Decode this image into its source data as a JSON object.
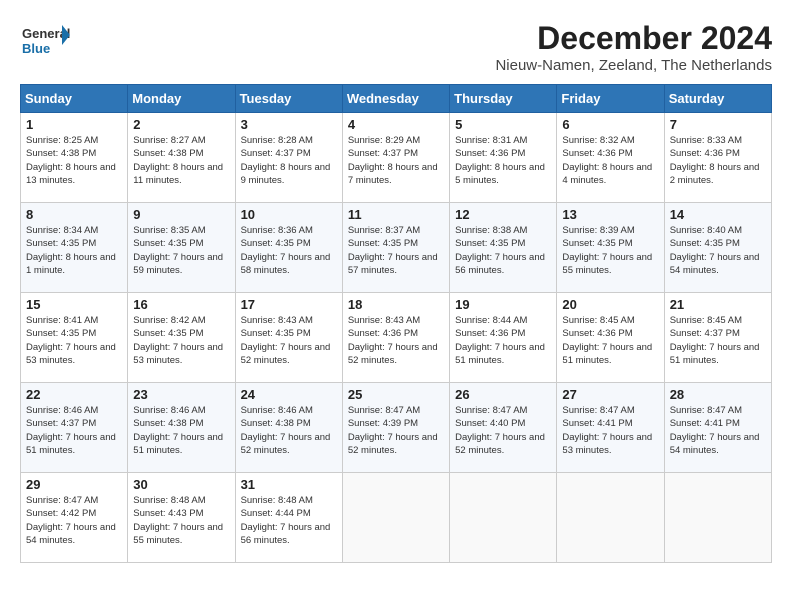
{
  "header": {
    "logo_general": "General",
    "logo_blue": "Blue",
    "main_title": "December 2024",
    "subtitle": "Nieuw-Namen, Zeeland, The Netherlands"
  },
  "calendar": {
    "days_of_week": [
      "Sunday",
      "Monday",
      "Tuesday",
      "Wednesday",
      "Thursday",
      "Friday",
      "Saturday"
    ],
    "weeks": [
      [
        null,
        {
          "day": 2,
          "sunrise": "Sunrise: 8:27 AM",
          "sunset": "Sunset: 4:38 PM",
          "daylight": "Daylight: 8 hours and 11 minutes."
        },
        {
          "day": 3,
          "sunrise": "Sunrise: 8:28 AM",
          "sunset": "Sunset: 4:37 PM",
          "daylight": "Daylight: 8 hours and 9 minutes."
        },
        {
          "day": 4,
          "sunrise": "Sunrise: 8:29 AM",
          "sunset": "Sunset: 4:37 PM",
          "daylight": "Daylight: 8 hours and 7 minutes."
        },
        {
          "day": 5,
          "sunrise": "Sunrise: 8:31 AM",
          "sunset": "Sunset: 4:36 PM",
          "daylight": "Daylight: 8 hours and 5 minutes."
        },
        {
          "day": 6,
          "sunrise": "Sunrise: 8:32 AM",
          "sunset": "Sunset: 4:36 PM",
          "daylight": "Daylight: 8 hours and 4 minutes."
        },
        {
          "day": 7,
          "sunrise": "Sunrise: 8:33 AM",
          "sunset": "Sunset: 4:36 PM",
          "daylight": "Daylight: 8 hours and 2 minutes."
        }
      ],
      [
        {
          "day": 1,
          "sunrise": "Sunrise: 8:25 AM",
          "sunset": "Sunset: 4:38 PM",
          "daylight": "Daylight: 8 hours and 13 minutes."
        },
        null,
        null,
        null,
        null,
        null,
        null
      ],
      [
        {
          "day": 8,
          "sunrise": "Sunrise: 8:34 AM",
          "sunset": "Sunset: 4:35 PM",
          "daylight": "Daylight: 8 hours and 1 minute."
        },
        {
          "day": 9,
          "sunrise": "Sunrise: 8:35 AM",
          "sunset": "Sunset: 4:35 PM",
          "daylight": "Daylight: 7 hours and 59 minutes."
        },
        {
          "day": 10,
          "sunrise": "Sunrise: 8:36 AM",
          "sunset": "Sunset: 4:35 PM",
          "daylight": "Daylight: 7 hours and 58 minutes."
        },
        {
          "day": 11,
          "sunrise": "Sunrise: 8:37 AM",
          "sunset": "Sunset: 4:35 PM",
          "daylight": "Daylight: 7 hours and 57 minutes."
        },
        {
          "day": 12,
          "sunrise": "Sunrise: 8:38 AM",
          "sunset": "Sunset: 4:35 PM",
          "daylight": "Daylight: 7 hours and 56 minutes."
        },
        {
          "day": 13,
          "sunrise": "Sunrise: 8:39 AM",
          "sunset": "Sunset: 4:35 PM",
          "daylight": "Daylight: 7 hours and 55 minutes."
        },
        {
          "day": 14,
          "sunrise": "Sunrise: 8:40 AM",
          "sunset": "Sunset: 4:35 PM",
          "daylight": "Daylight: 7 hours and 54 minutes."
        }
      ],
      [
        {
          "day": 15,
          "sunrise": "Sunrise: 8:41 AM",
          "sunset": "Sunset: 4:35 PM",
          "daylight": "Daylight: 7 hours and 53 minutes."
        },
        {
          "day": 16,
          "sunrise": "Sunrise: 8:42 AM",
          "sunset": "Sunset: 4:35 PM",
          "daylight": "Daylight: 7 hours and 53 minutes."
        },
        {
          "day": 17,
          "sunrise": "Sunrise: 8:43 AM",
          "sunset": "Sunset: 4:35 PM",
          "daylight": "Daylight: 7 hours and 52 minutes."
        },
        {
          "day": 18,
          "sunrise": "Sunrise: 8:43 AM",
          "sunset": "Sunset: 4:36 PM",
          "daylight": "Daylight: 7 hours and 52 minutes."
        },
        {
          "day": 19,
          "sunrise": "Sunrise: 8:44 AM",
          "sunset": "Sunset: 4:36 PM",
          "daylight": "Daylight: 7 hours and 51 minutes."
        },
        {
          "day": 20,
          "sunrise": "Sunrise: 8:45 AM",
          "sunset": "Sunset: 4:36 PM",
          "daylight": "Daylight: 7 hours and 51 minutes."
        },
        {
          "day": 21,
          "sunrise": "Sunrise: 8:45 AM",
          "sunset": "Sunset: 4:37 PM",
          "daylight": "Daylight: 7 hours and 51 minutes."
        }
      ],
      [
        {
          "day": 22,
          "sunrise": "Sunrise: 8:46 AM",
          "sunset": "Sunset: 4:37 PM",
          "daylight": "Daylight: 7 hours and 51 minutes."
        },
        {
          "day": 23,
          "sunrise": "Sunrise: 8:46 AM",
          "sunset": "Sunset: 4:38 PM",
          "daylight": "Daylight: 7 hours and 51 minutes."
        },
        {
          "day": 24,
          "sunrise": "Sunrise: 8:46 AM",
          "sunset": "Sunset: 4:38 PM",
          "daylight": "Daylight: 7 hours and 52 minutes."
        },
        {
          "day": 25,
          "sunrise": "Sunrise: 8:47 AM",
          "sunset": "Sunset: 4:39 PM",
          "daylight": "Daylight: 7 hours and 52 minutes."
        },
        {
          "day": 26,
          "sunrise": "Sunrise: 8:47 AM",
          "sunset": "Sunset: 4:40 PM",
          "daylight": "Daylight: 7 hours and 52 minutes."
        },
        {
          "day": 27,
          "sunrise": "Sunrise: 8:47 AM",
          "sunset": "Sunset: 4:41 PM",
          "daylight": "Daylight: 7 hours and 53 minutes."
        },
        {
          "day": 28,
          "sunrise": "Sunrise: 8:47 AM",
          "sunset": "Sunset: 4:41 PM",
          "daylight": "Daylight: 7 hours and 54 minutes."
        }
      ],
      [
        {
          "day": 29,
          "sunrise": "Sunrise: 8:47 AM",
          "sunset": "Sunset: 4:42 PM",
          "daylight": "Daylight: 7 hours and 54 minutes."
        },
        {
          "day": 30,
          "sunrise": "Sunrise: 8:48 AM",
          "sunset": "Sunset: 4:43 PM",
          "daylight": "Daylight: 7 hours and 55 minutes."
        },
        {
          "day": 31,
          "sunrise": "Sunrise: 8:48 AM",
          "sunset": "Sunset: 4:44 PM",
          "daylight": "Daylight: 7 hours and 56 minutes."
        },
        null,
        null,
        null,
        null
      ]
    ]
  }
}
